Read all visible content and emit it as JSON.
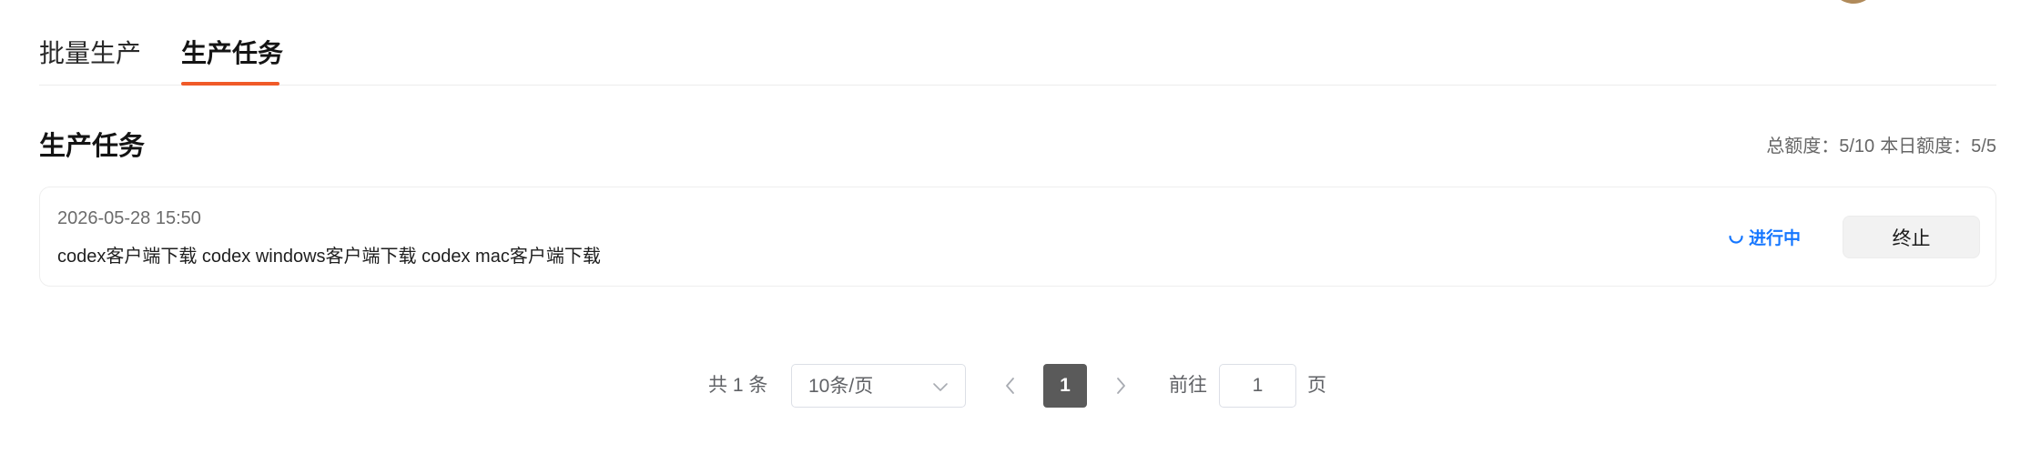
{
  "tabs": [
    {
      "label": "批量生产",
      "active": false
    },
    {
      "label": "生产任务",
      "active": true
    }
  ],
  "accent_color": "#f05a28",
  "section": {
    "title": "生产任务",
    "quota_total": "总额度：5/10",
    "quota_daily": "本日额度：5/5"
  },
  "task": {
    "time": "2026-05-28 15:50",
    "names": "codex客户端下载 codex windows客户端下载 codex mac客户端下载",
    "status": "进行中",
    "status_color": "#1677ff",
    "status_icon": "spinner-icon",
    "stop_label": "终止"
  },
  "pagination": {
    "total": "共 1 条",
    "page_size": "10条/页",
    "current_page": "1",
    "goto_label": "前往",
    "goto_value": "1",
    "page_suffix": "页"
  }
}
